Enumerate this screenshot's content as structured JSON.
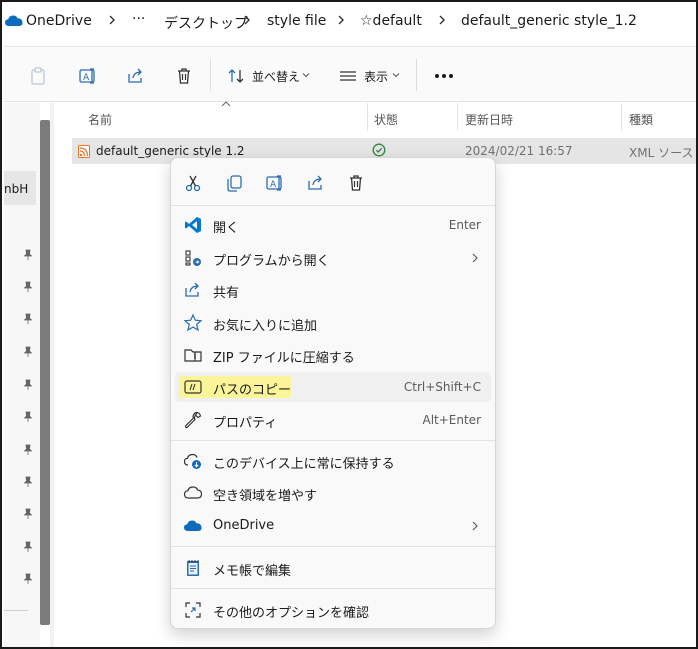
{
  "breadcrumb": {
    "items": [
      "OneDrive",
      "デスクトップ",
      "style file",
      "☆default",
      "default_generic style_1.2"
    ],
    "more": "···"
  },
  "toolbar": {
    "sort_label": "並べ替え",
    "view_label": "表示"
  },
  "left_nav": {
    "selected_label": "nbH"
  },
  "columns": {
    "name": "名前",
    "status": "状態",
    "modified": "更新日時",
    "type": "種類"
  },
  "file": {
    "name": "default_generic style 1.2",
    "modified": "2024/02/21 16:57",
    "type": "XML ソース ファ"
  },
  "context_menu": {
    "items": [
      {
        "label": "開く",
        "shortcut": "Enter"
      },
      {
        "label": "プログラムから開く"
      },
      {
        "label": "共有"
      },
      {
        "label": "お気に入りに追加"
      },
      {
        "label": "ZIP ファイルに圧縮する"
      },
      {
        "label": "パスのコピー",
        "shortcut": "Ctrl+Shift+C"
      },
      {
        "label": "プロパティ",
        "shortcut": "Alt+Enter"
      },
      {
        "label": "このデバイス上に常に保持する"
      },
      {
        "label": "空き領域を増やす"
      },
      {
        "label": "OneDrive"
      },
      {
        "label": "メモ帳で編集"
      },
      {
        "label": "その他のオプションを確認"
      }
    ]
  },
  "colors": {
    "onedrive_blue": "#0f6cbd",
    "vscode_blue": "#0078d4",
    "highlight_yellow": "#fbf59a",
    "status_green": "#2e8540",
    "rss_orange": "#e8742b"
  }
}
